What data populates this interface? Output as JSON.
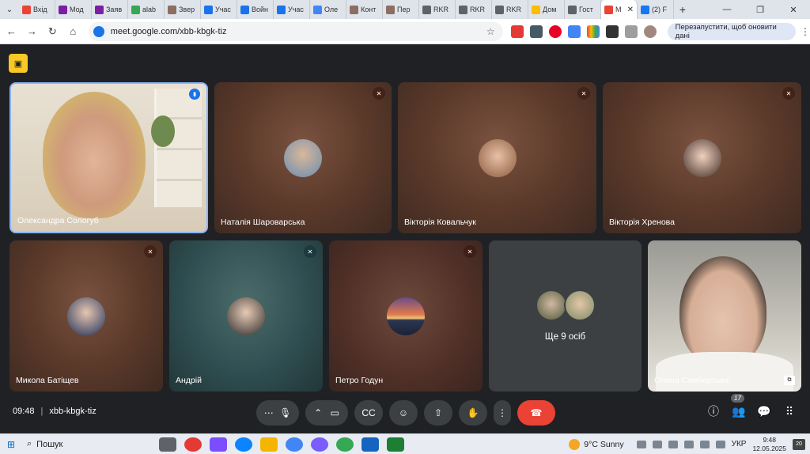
{
  "browser": {
    "tabs": [
      {
        "label": "Вхід",
        "icon": "gmail-icon",
        "color": "#ea4335"
      },
      {
        "label": "Мод",
        "icon": "meet-icon",
        "color": "#7b1fa2"
      },
      {
        "label": "Заяв",
        "icon": "meet-icon",
        "color": "#7b1fa2"
      },
      {
        "label": "alab",
        "icon": "apps-icon",
        "color": "#34a853"
      },
      {
        "label": "Звер",
        "icon": "box-icon",
        "color": "#8d6e63"
      },
      {
        "label": "Учас",
        "icon": "globe-icon",
        "color": "#1a73e8"
      },
      {
        "label": "Войн",
        "icon": "globe-icon",
        "color": "#1a73e8"
      },
      {
        "label": "Учас",
        "icon": "globe-icon",
        "color": "#1a73e8"
      },
      {
        "label": "Оле",
        "icon": "google-icon",
        "color": "#4285f4"
      },
      {
        "label": "Конт",
        "icon": "box-icon",
        "color": "#8d6e63"
      },
      {
        "label": "Пер",
        "icon": "box-icon",
        "color": "#8d6e63"
      },
      {
        "label": "RKR",
        "icon": "globe-icon",
        "color": "#5f6368"
      },
      {
        "label": "RKR",
        "icon": "globe-icon",
        "color": "#5f6368"
      },
      {
        "label": "RKR",
        "icon": "globe-icon",
        "color": "#5f6368"
      },
      {
        "label": "Дом",
        "icon": "drive-icon",
        "color": "#fbbc04"
      },
      {
        "label": "Гост",
        "icon": "globe-icon",
        "color": "#5f6368"
      },
      {
        "label": "М",
        "icon": "record-icon",
        "color": "#ea4335",
        "active": true
      },
      {
        "label": "(2) F",
        "icon": "facebook-icon",
        "color": "#1877f2"
      }
    ],
    "url": "meet.google.com/xbb-kbgk-tiz",
    "restart_label": "Перезапустити, щоб оновити дані"
  },
  "meet": {
    "participants": {
      "alexandra": "Олександра Сологуб",
      "natalia": "Наталія Шароварська",
      "viktoria_k": "Вікторія Ковальчук",
      "viktoria_kh": "Вікторія Хренова",
      "mykola": "Микола Батіщев",
      "andrii": "Андрій",
      "petro": "Петро Годун",
      "olena": "Олена Самборська"
    },
    "more_label": "Ще 9 осіб",
    "time": "09:48",
    "code": "xbb-kbgk-tiz",
    "people_count": "17"
  },
  "taskbar": {
    "search_label": "Пошук",
    "weather": "9°C  Sunny",
    "lang": "УКР",
    "time": "9:48",
    "date": "12.05.2025",
    "notifications": "20"
  }
}
